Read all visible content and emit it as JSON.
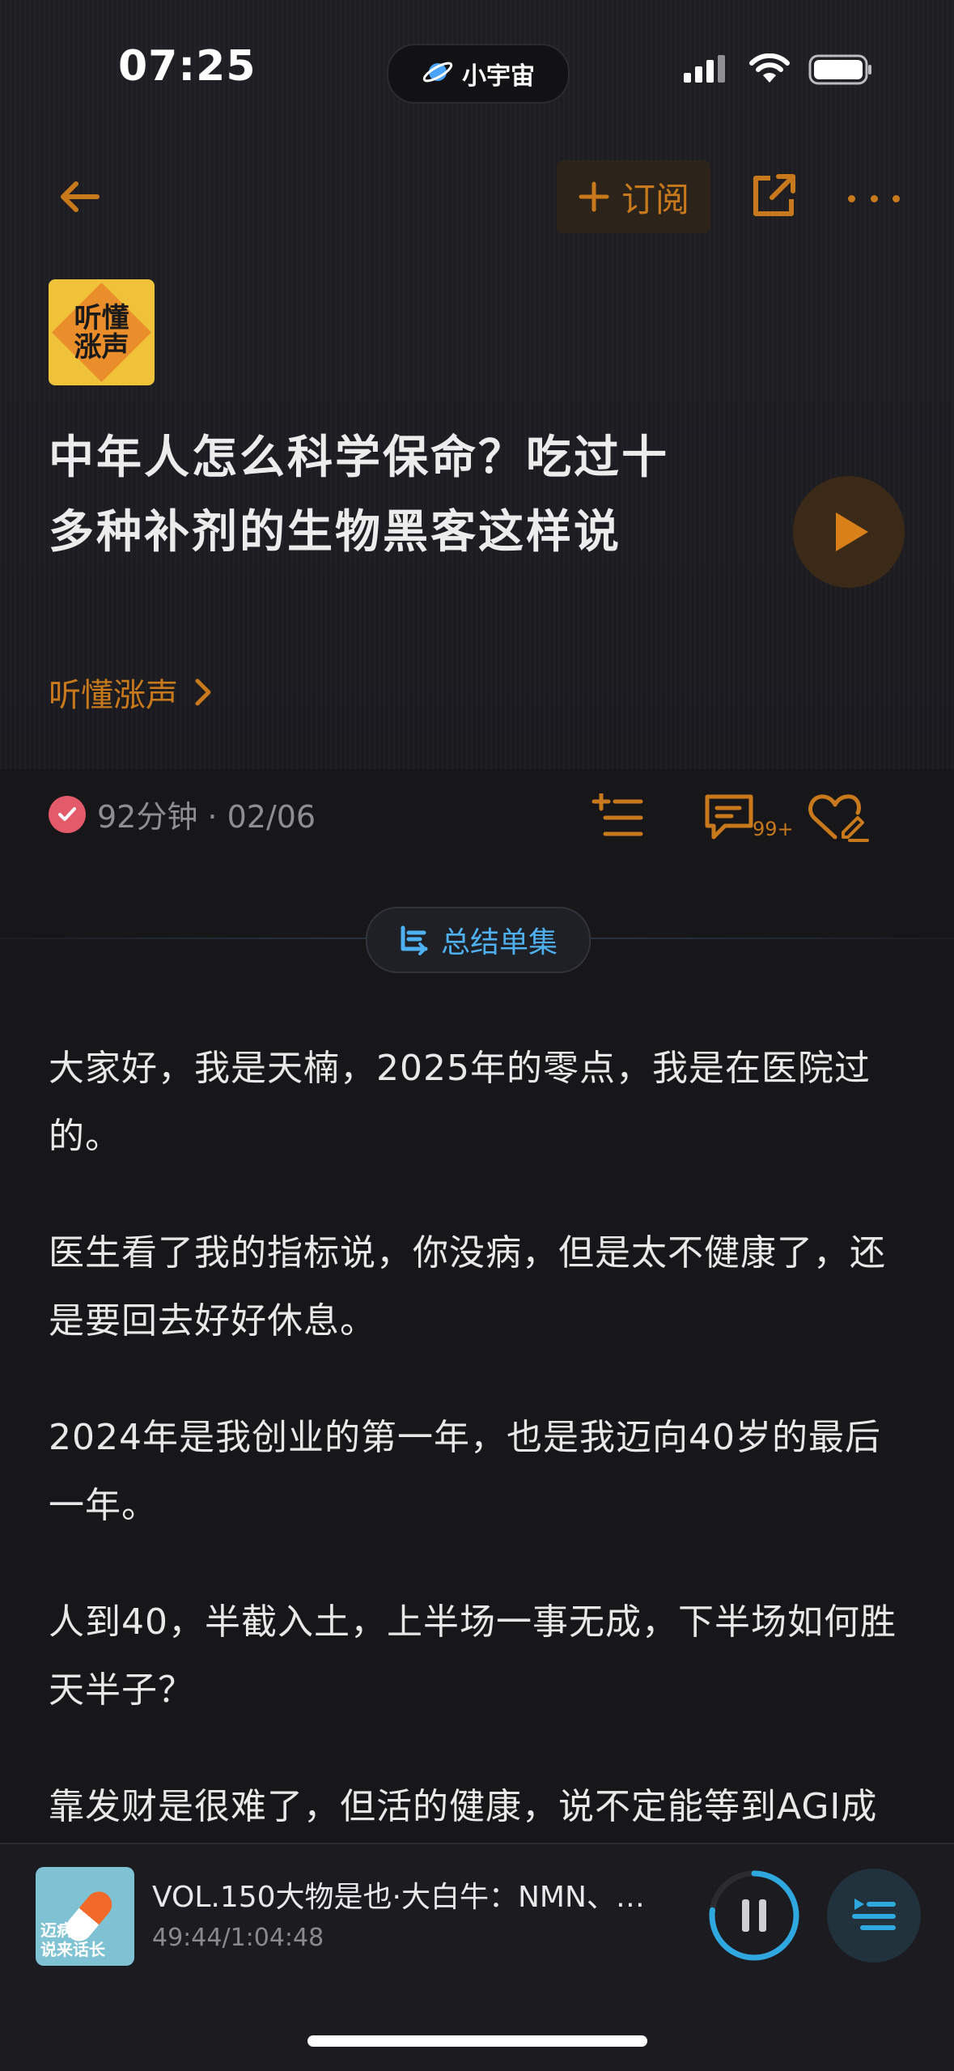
{
  "status_bar": {
    "time": "07:25",
    "island_label": "小宇宙",
    "icons": [
      "cellular-signal-icon",
      "wifi-icon",
      "battery-icon"
    ]
  },
  "nav": {
    "back_icon": "arrow-left-icon",
    "subscribe_label": "订阅",
    "share_icon": "share-icon",
    "more_icon": "more-dots-icon",
    "accent_color": "#c8791c"
  },
  "episode": {
    "cover_text_line1": "听懂",
    "cover_text_line2": "涨声",
    "title": "中年人怎么科学保命？吃过十多种补剂的生物黑客这样说",
    "podcast_name": "听懂涨声",
    "duration_date": "92分钟 · 02/06",
    "comment_count": "99+"
  },
  "summary_button": {
    "label": "总结单集"
  },
  "article": {
    "paragraphs": [
      "大家好，我是天楠，2025年的零点，我是在医院过的。",
      "医生看了我的指标说，你没病，但是太不健康了，还是要回去好好休息。",
      "2024年是我创业的第一年，也是我迈向40岁的最后一年。",
      "人到40，半截入土，上半场一事无成，下半场如何胜天半子？",
      "靠发财是很难了，但活的健康，说不定能等到AGI成"
    ]
  },
  "player": {
    "cover_text_line1": "迈病",
    "cover_text_line2": "说来话长",
    "title": "VOL.150大物是也·大白牛：NMN、…",
    "time": "49:44/1:04:48",
    "progress": 0.77,
    "progress_color": "#2fa8e0"
  }
}
